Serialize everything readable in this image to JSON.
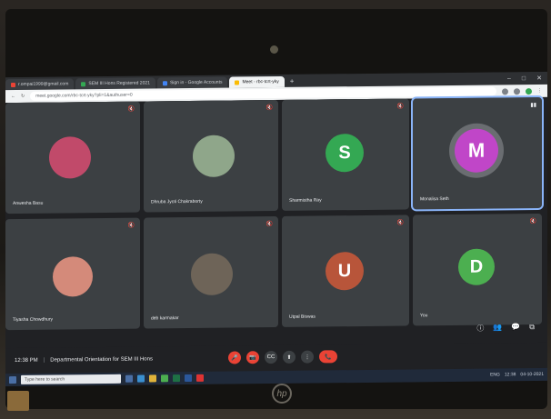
{
  "browser": {
    "tabs": [
      {
        "label": "r.ompai1999@gmail.com",
        "color": "#ea4335"
      },
      {
        "label": "SEM III Hons Registered 2021",
        "color": "#34a853"
      },
      {
        "label": "Sign in - Google Accounts",
        "color": "#4285f4"
      },
      {
        "label": "Meet - rbc-tcrt-yky",
        "color": "#fbbc04"
      }
    ],
    "new_tab": "+",
    "window_controls": [
      "–",
      "□",
      "✕"
    ],
    "url": "meet.google.com/rbc-tcrt-yky?pli=1&authuser=0"
  },
  "participants": [
    {
      "name": "Anwesha Basu",
      "initial": "",
      "avatar_color": "#c14a6a"
    },
    {
      "name": "Dhruba Jyoti Chakraborty",
      "initial": "",
      "avatar_color": "#8fa68a"
    },
    {
      "name": "Sharmistha Ray",
      "initial": "S",
      "avatar_color": "#34a853"
    },
    {
      "name": "Monalisa Seth",
      "initial": "M",
      "avatar_color": "#c046c8"
    },
    {
      "name": "Tiyasha Chowdhury",
      "initial": "",
      "avatar_color": "#d48a7a"
    },
    {
      "name": "deb karmakar",
      "initial": "",
      "avatar_color": "#6e6458"
    },
    {
      "name": "Utpal Biswas",
      "initial": "U",
      "avatar_color": "#b8553a"
    },
    {
      "name": "You",
      "initial": "D",
      "avatar_color": "#4caf50"
    }
  ],
  "meeting": {
    "time": "12:38 PM",
    "separator": "|",
    "title": "Departmental Orientation for SEM III Hons"
  },
  "controls": {
    "mic": "🎤",
    "camera": "📷",
    "captions": "CC",
    "present": "⬆",
    "more": "⋮",
    "end_call": "📞"
  },
  "side_controls": [
    "ⓘ",
    "👥",
    "💬",
    "⧉"
  ],
  "taskbar": {
    "search_placeholder": "Type here to search",
    "time": "12:38",
    "date": "04-10-2021",
    "lang": "ENG"
  },
  "logo": "hp"
}
